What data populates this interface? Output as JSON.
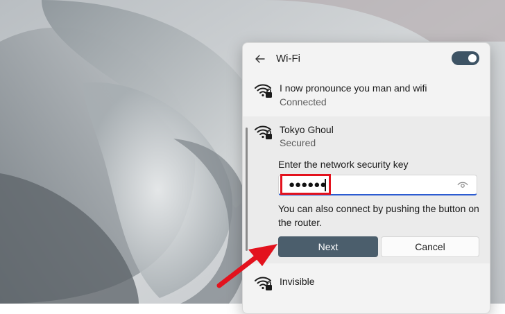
{
  "panel": {
    "title": "Wi-Fi",
    "wifi_enabled": true
  },
  "networks": [
    {
      "name": "I now pronounce you man and wifi",
      "status": "Connected",
      "icon": "wifi-secured-icon"
    },
    {
      "name": "Tokyo Ghoul",
      "status": "Secured",
      "icon": "wifi-secured-icon"
    },
    {
      "name": "Invisible",
      "status": "",
      "icon": "wifi-secured-icon"
    }
  ],
  "connect_form": {
    "key_label": "Enter the network security key",
    "key_value": "●●●●●●",
    "router_hint": "You can also connect by pushing the button on the router.",
    "next_label": "Next",
    "cancel_label": "Cancel"
  },
  "colors": {
    "accent": "#2b5bd1",
    "next_button": "#4b5e6c",
    "highlight": "#e3121d"
  }
}
